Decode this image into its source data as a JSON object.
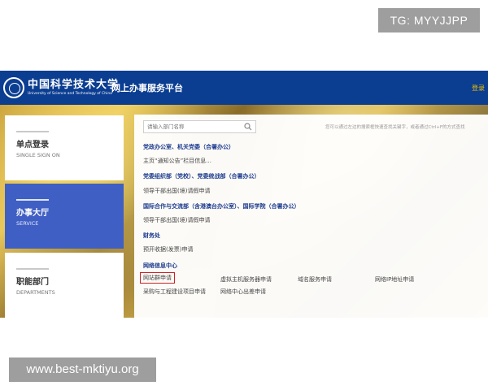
{
  "watermark": {
    "tag": "TG: MYYJJPP",
    "site": "www.best-mktiyu.org"
  },
  "header": {
    "logo_cn": "中国科学技术大学",
    "logo_en": "University of Science and Technology of China",
    "title": "网上办事服务平台",
    "login": "登录",
    "bg_color": "#0b3d91"
  },
  "nav": [
    {
      "cn": "单点登录",
      "en": "SINGLE SIGN ON"
    },
    {
      "cn": "办事大厅",
      "en": "SERVICE",
      "active": true
    },
    {
      "cn": "职能部门",
      "en": "DEPARTMENTS"
    }
  ],
  "search": {
    "placeholder": "请输入部门名称",
    "hint": "您可以通过左边的搜索框快速查找关键字，或者通过Ctrl+F的方式查找"
  },
  "sections": [
    {
      "title": "党政办公室、机关党委（合署办公）",
      "items": [
        "主页“通知公告”栏目信息..."
      ]
    },
    {
      "title": "党委组织部（党校）、党委统战部（合署办公）",
      "items": [
        "领导干部出国(境)请假申请"
      ]
    },
    {
      "title": "国际合作与交流部（含港澳台办公室）、国际学院（合署办公）",
      "items": [
        "领导干部出国(境)请假申请"
      ]
    },
    {
      "title": "财务处",
      "items": [
        "预开收据(发票)申请"
      ]
    },
    {
      "title": "网络信息中心",
      "items": [
        "网站群申请",
        "虚拟主机服务器申请",
        "域名服务申请",
        "网络IP地址申请",
        "采购与工程建设项目申请",
        "网络中心出差申请"
      ]
    }
  ],
  "colors": {
    "accent": "#3f5fc4",
    "highlight_box": "#cc2222",
    "section_title": "#1c3b8f"
  }
}
